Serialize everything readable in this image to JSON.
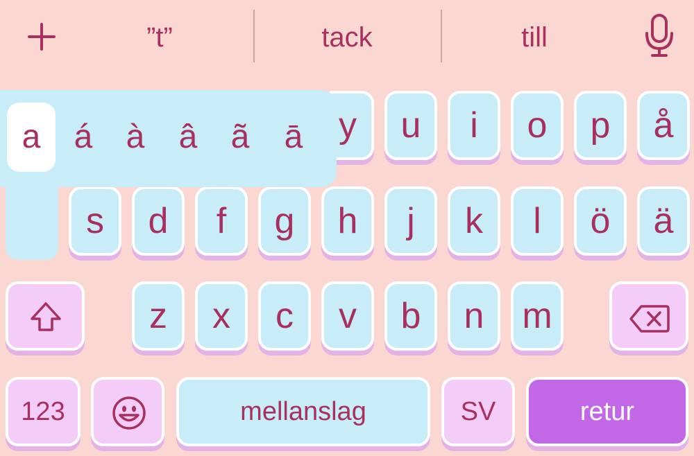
{
  "suggestions": {
    "add_icon": "plus-icon",
    "items": [
      "”t”",
      "tack",
      "till"
    ],
    "mic_icon": "microphone-icon"
  },
  "accent_popup": {
    "options": [
      "a",
      "á",
      "à",
      "â",
      "ã",
      "ā"
    ],
    "selected": "a"
  },
  "rows": {
    "row1_visible": [
      "y",
      "u",
      "i",
      "o",
      "p",
      "å"
    ],
    "row2": [
      "s",
      "d",
      "f",
      "g",
      "h",
      "j",
      "k",
      "l",
      "ö",
      "ä"
    ],
    "row3": [
      "z",
      "x",
      "c",
      "v",
      "b",
      "n",
      "m"
    ]
  },
  "bottom_row": {
    "numbers_label": "123",
    "space_label": "mellanslag",
    "language_label": "SV",
    "return_label": "retur"
  },
  "colors": {
    "background": "#fbd7d2",
    "key": "#c8edf9",
    "modifier_key": "#f3cdf7",
    "return_key": "#c267e6",
    "text": "#a8305e"
  }
}
